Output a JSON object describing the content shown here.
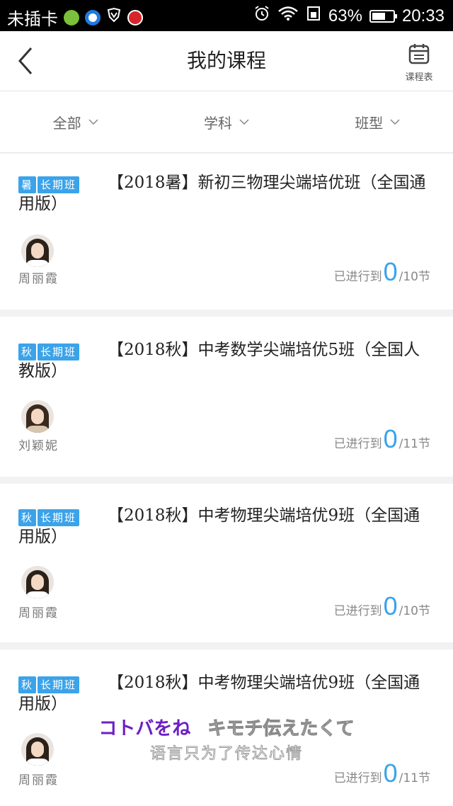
{
  "status_bar": {
    "carrier": "未插卡",
    "battery": "63%",
    "battery_level": 0.63,
    "time": "20:33"
  },
  "nav": {
    "title": "我的课程",
    "schedule_label": "课程表"
  },
  "filters": [
    {
      "label": "全部"
    },
    {
      "label": "学科"
    },
    {
      "label": "班型"
    }
  ],
  "courses": [
    {
      "tags": [
        "暑",
        "长期班"
      ],
      "title": "【2018暑】新初三物理尖端培优班（全国通用版）",
      "teacher": "周丽霞",
      "progress_prefix": "已进行到",
      "done": "0",
      "total": "/10节"
    },
    {
      "tags": [
        "秋",
        "长期班"
      ],
      "title": "【2018秋】中考数学尖端培优5班（全国人教版）",
      "teacher": "刘颖妮",
      "progress_prefix": "已进行到",
      "done": "0",
      "total": "/11节"
    },
    {
      "tags": [
        "秋",
        "长期班"
      ],
      "title": "【2018秋】中考物理尖端培优9班（全国通用版）",
      "teacher": "周丽霞",
      "progress_prefix": "已进行到",
      "done": "0",
      "total": "/10节"
    },
    {
      "tags": [
        "秋",
        "长期班"
      ],
      "title": "【2018秋】中考物理尖端培优9班（全国通用版）",
      "teacher": "周丽霞",
      "progress_prefix": "已进行到",
      "done": "0",
      "total": "/11节"
    }
  ],
  "subtitle": {
    "line1_a": "コトバをね",
    "line1_b": "キモチ伝えたくて",
    "line2": "语言只为了传达心情"
  },
  "colors": {
    "accent": "#3aa3ea",
    "subtitle_purple": "#6d1fc2"
  }
}
